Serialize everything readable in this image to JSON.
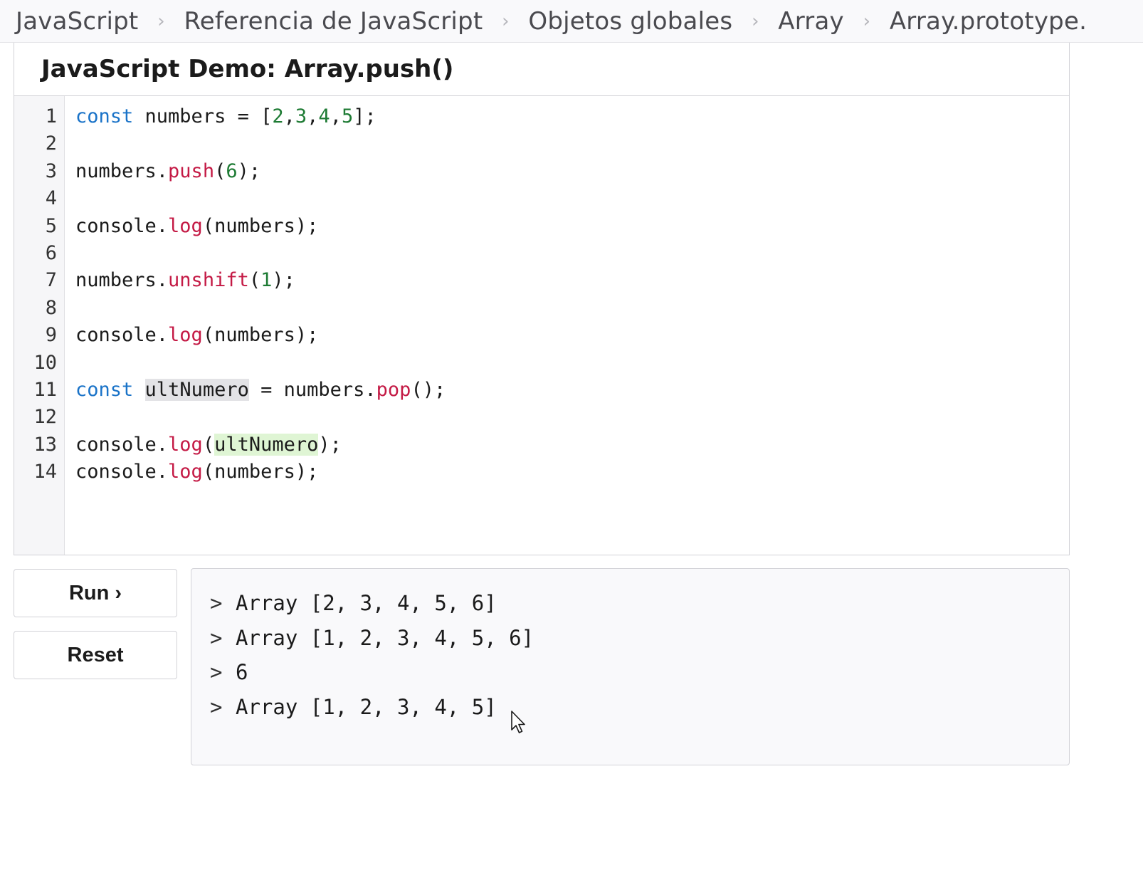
{
  "breadcrumb": {
    "items": [
      "JavaScript",
      "Referencia de JavaScript",
      "Objetos globales",
      "Array",
      "Array.prototype."
    ],
    "separator": "›"
  },
  "demo": {
    "title": "JavaScript Demo: Array.push()"
  },
  "editor": {
    "line_numbers": [
      "1",
      "2",
      "3",
      "4",
      "5",
      "6",
      "7",
      "8",
      "9",
      "10",
      "11",
      "12",
      "13",
      "14"
    ],
    "lines": [
      [
        {
          "t": "kw",
          "v": "const"
        },
        {
          "t": "",
          "v": " numbers = ["
        },
        {
          "t": "num",
          "v": "2"
        },
        {
          "t": "",
          "v": ","
        },
        {
          "t": "num",
          "v": "3"
        },
        {
          "t": "",
          "v": ","
        },
        {
          "t": "num",
          "v": "4"
        },
        {
          "t": "",
          "v": ","
        },
        {
          "t": "num",
          "v": "5"
        },
        {
          "t": "",
          "v": "];"
        }
      ],
      [],
      [
        {
          "t": "",
          "v": "numbers."
        },
        {
          "t": "fn",
          "v": "push"
        },
        {
          "t": "",
          "v": "("
        },
        {
          "t": "num",
          "v": "6"
        },
        {
          "t": "",
          "v": ");"
        }
      ],
      [],
      [
        {
          "t": "",
          "v": "console."
        },
        {
          "t": "fn",
          "v": "log"
        },
        {
          "t": "",
          "v": "(numbers);"
        }
      ],
      [],
      [
        {
          "t": "",
          "v": "numbers."
        },
        {
          "t": "fn",
          "v": "unshift"
        },
        {
          "t": "",
          "v": "("
        },
        {
          "t": "num",
          "v": "1"
        },
        {
          "t": "",
          "v": ");"
        }
      ],
      [],
      [
        {
          "t": "",
          "v": "console."
        },
        {
          "t": "fn",
          "v": "log"
        },
        {
          "t": "",
          "v": "(numbers);"
        }
      ],
      [],
      [
        {
          "t": "kw",
          "v": "const"
        },
        {
          "t": "",
          "v": " "
        },
        {
          "t": "sel",
          "v": "ultNumero"
        },
        {
          "t": "",
          "v": " = numbers."
        },
        {
          "t": "fn",
          "v": "pop"
        },
        {
          "t": "",
          "v": "();"
        }
      ],
      [],
      [
        {
          "t": "",
          "v": "console."
        },
        {
          "t": "fn",
          "v": "log"
        },
        {
          "t": "",
          "v": "("
        },
        {
          "t": "match",
          "v": "ultNumero"
        },
        {
          "t": "",
          "v": ");"
        }
      ],
      [
        {
          "t": "",
          "v": "console."
        },
        {
          "t": "fn",
          "v": "log"
        },
        {
          "t": "",
          "v": "(numbers);"
        }
      ]
    ]
  },
  "buttons": {
    "run_label": "Run ›",
    "reset_label": "Reset"
  },
  "console": {
    "prompt": ">",
    "lines": [
      "Array [2, 3, 4, 5, 6]",
      "Array [1, 2, 3, 4, 5, 6]",
      "6",
      "Array [1, 2, 3, 4, 5]"
    ]
  },
  "icons": {
    "cursor": "mouse-pointer-icon"
  }
}
